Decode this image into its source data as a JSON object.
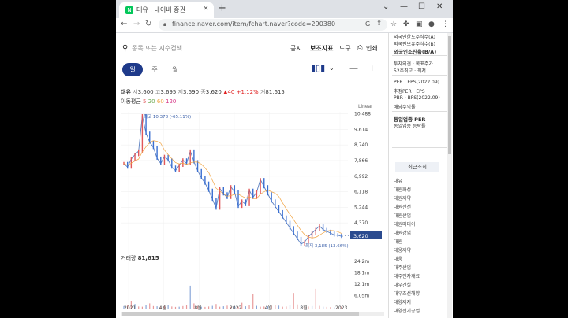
{
  "browser": {
    "tab_title": "대유 : 네이버 증권",
    "tab_favicon": "N",
    "tab_close": "×",
    "new_tab": "+",
    "url": "finance.naver.com/item/fchart.naver?code=290380",
    "window_controls": [
      "⌄",
      "—",
      "☐",
      "✕"
    ]
  },
  "header": {
    "search_placeholder": "종목 또는 지수검색",
    "menu": [
      "공시",
      "보조지표",
      "도구",
      "인쇄"
    ]
  },
  "periods": [
    "일",
    "주",
    "월"
  ],
  "active_period": "일",
  "quote": {
    "name": "대유",
    "open_label": "시",
    "open": "3,600",
    "high_label": "고",
    "high": "3,695",
    "low_label": "저",
    "low": "3,590",
    "close_label": "종",
    "close": "3,620",
    "change": "▲40",
    "change_pct": "+1.12%",
    "volume_label": "거",
    "volume": "81,615"
  },
  "ma_legend": {
    "label": "이동평균",
    "periods": [
      "5",
      "20",
      "60",
      "120"
    ],
    "colors": [
      "#e15759",
      "#6aa84f",
      "#f1a340",
      "#d63384"
    ]
  },
  "scale_label": "Linear",
  "chart_data": [
    {
      "type": "line",
      "title": "",
      "xlabel": "",
      "ylabel": "",
      "x_ticks": [
        "2021",
        "4월",
        "8월",
        "2022",
        "4월",
        "8월",
        "2023"
      ],
      "y_ticks": [
        10488,
        9614,
        8740,
        7866,
        6992,
        6118,
        5244,
        4370
      ],
      "ylim": [
        3100,
        10600
      ],
      "current_price": "3,620",
      "high_annotation": "최고 10,378 (-65.11%)",
      "low_annotation": "최저 3,185 (13.66%)",
      "series": [
        {
          "values": [
            7700,
            7500,
            7950,
            8200,
            8400,
            10378,
            9400,
            8900,
            8600,
            8000,
            7700,
            8100,
            7900,
            7500,
            7300,
            7600,
            7900,
            7700,
            8400,
            7800,
            7300,
            6900,
            6600,
            6200,
            5700,
            5200,
            6300,
            6000,
            5800,
            6400,
            6100,
            5300,
            5600,
            5400,
            6200,
            5800,
            6100,
            6800,
            6400,
            6000,
            5600,
            5300,
            5000,
            4700,
            4400,
            4100,
            3800,
            3500,
            3185,
            3300,
            3600,
            3800,
            4000,
            4200,
            4000,
            3900,
            3800,
            3700,
            3680,
            3620
          ]
        }
      ]
    },
    {
      "type": "bar",
      "title": "거래량",
      "ylabel": "",
      "y_ticks": [
        "24.2m",
        "18.1m",
        "12.1m",
        "6.05m"
      ],
      "ylim": [
        0,
        24200000
      ],
      "values": [
        1200000,
        1800000,
        3500000,
        2200000,
        1000000,
        900000,
        1600000,
        2500000,
        1200000,
        1100000,
        900000,
        1300000,
        1700000,
        1000000,
        800000,
        900000,
        1200000,
        1500000,
        11000000,
        2500000,
        1200000,
        900000,
        800000,
        1000000,
        1300000,
        2200000,
        900000,
        1100000,
        1400000,
        800000,
        1200000,
        900000,
        2800000,
        1100000,
        1500000,
        7000000,
        1300000,
        900000,
        1000000,
        1100000,
        1300000,
        1800000,
        1400000,
        900000,
        1000000,
        1600000,
        7500000,
        2000000,
        1500000,
        900000,
        1000000,
        1200000,
        9500000,
        1300000,
        900000,
        800000,
        700000,
        600000,
        900000,
        1000000
      ]
    }
  ],
  "sidebar": {
    "foreign_limit": "외국인한도주식수(A)",
    "foreign_holding": "외국인보유주식수(B)",
    "foreign_rate": "외국인소진율(B/A)",
    "opinion": "투자의견 · 목표주가",
    "week52": "52주최고 · 최저",
    "per_label": "PER",
    "eps_label": "EPS(2022.09)",
    "est_per": "추정PER · EPS",
    "pbr_label": "PBR",
    "bps_label": "BPS(2022.09)",
    "dividend": "배당수익률",
    "industry_per": "동일업종 PER",
    "industry_change": "동일업종 등락률",
    "recent_title": "최근조회",
    "recent_items": [
      "대유",
      "대원화성",
      "대원제약",
      "대원전선",
      "대원산업",
      "대원미디어",
      "대원강업",
      "대원",
      "대웅제약",
      "대웅",
      "대주산업",
      "대주전자재료",
      "대우건설",
      "대우조선해양",
      "대양제지",
      "대양전기공업"
    ]
  }
}
